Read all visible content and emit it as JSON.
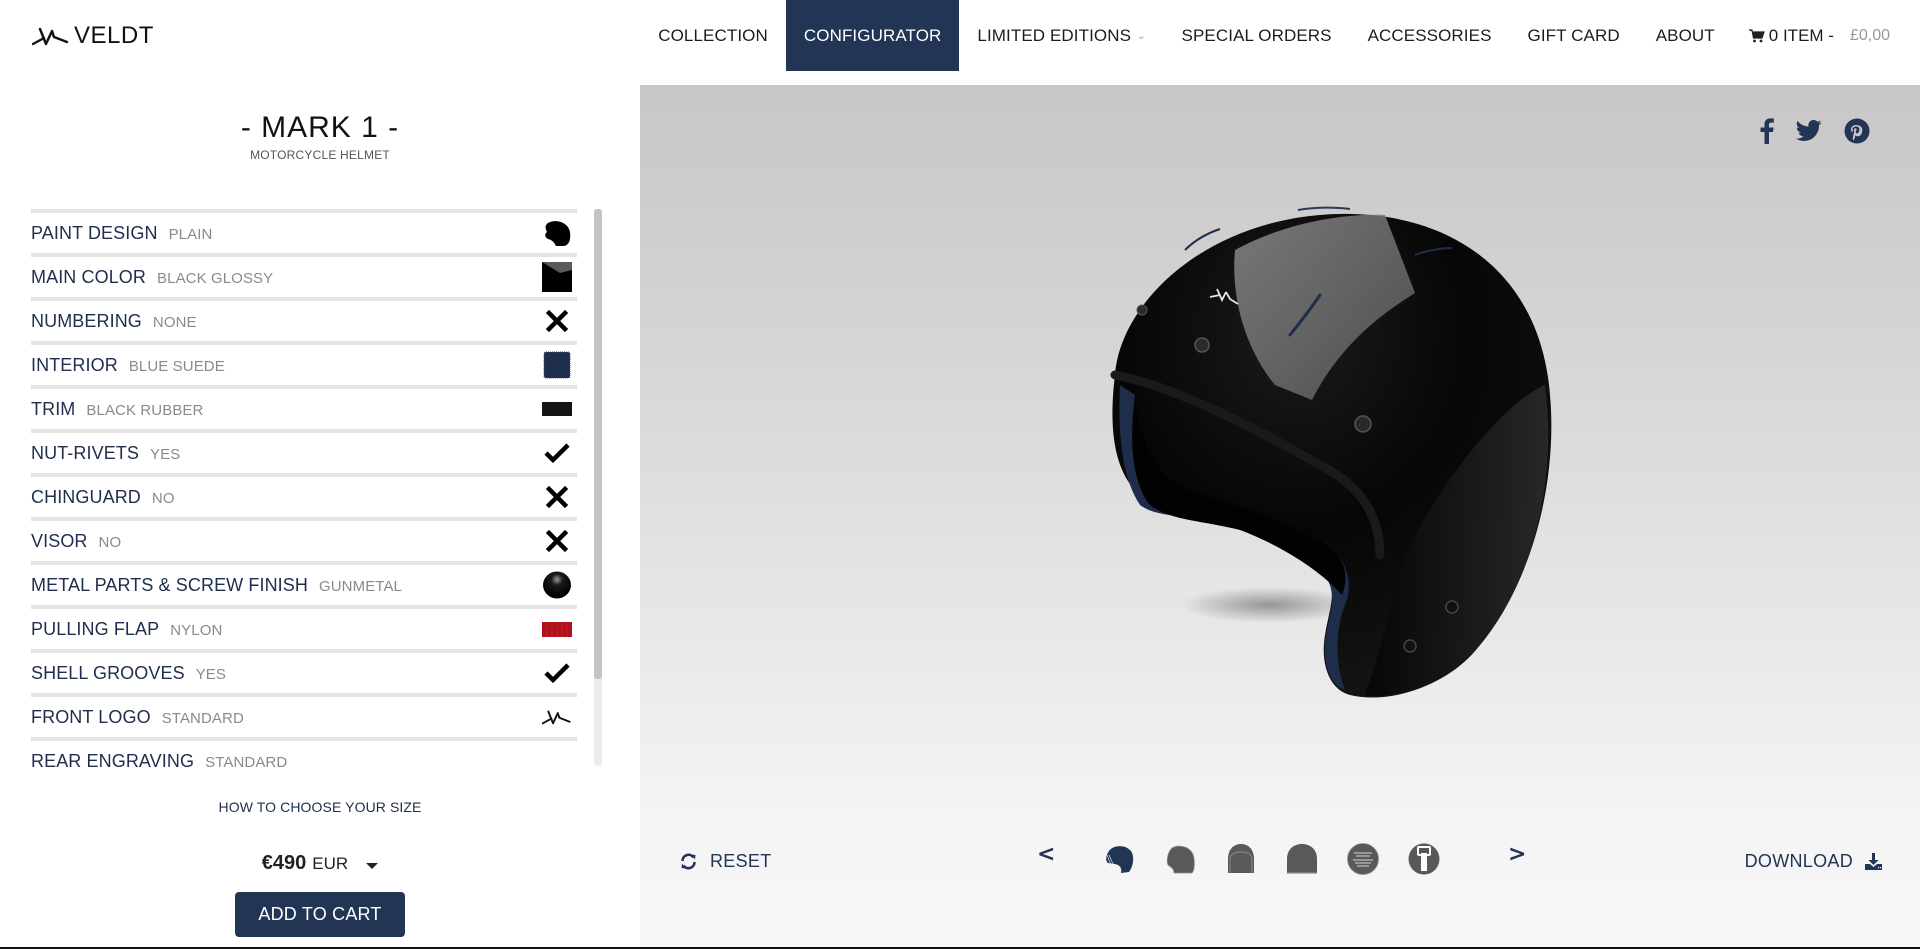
{
  "brand": {
    "name": "VELDT",
    "logo_icon": "veldt-mark-icon"
  },
  "nav": {
    "items": [
      {
        "label": "COLLECTION",
        "active": false,
        "has_dropdown": false
      },
      {
        "label": "CONFIGURATOR",
        "active": true,
        "has_dropdown": false
      },
      {
        "label": "LIMITED EDITIONS",
        "active": false,
        "has_dropdown": true
      },
      {
        "label": "SPECIAL ORDERS",
        "active": false,
        "has_dropdown": false
      },
      {
        "label": "ACCESSORIES",
        "active": false,
        "has_dropdown": false
      },
      {
        "label": "GIFT CARD",
        "active": false,
        "has_dropdown": false
      },
      {
        "label": "ABOUT",
        "active": false,
        "has_dropdown": false
      }
    ],
    "cart": {
      "icon": "cart-icon",
      "count_label": "0 ITEM -",
      "amount": "£0,00"
    }
  },
  "product": {
    "title": "- MARK 1 -",
    "subtitle": "MOTORCYCLE HELMET"
  },
  "options": [
    {
      "name": "PAINT DESIGN",
      "value": "PLAIN",
      "icon": "helmet-silhouette-icon"
    },
    {
      "name": "MAIN COLOR",
      "value": "BLACK GLOSSY",
      "icon": "black-glossy-swatch-icon"
    },
    {
      "name": "NUMBERING",
      "value": "NONE",
      "icon": "cross-icon"
    },
    {
      "name": "INTERIOR",
      "value": "BLUE SUEDE",
      "icon": "blue-suede-swatch-icon"
    },
    {
      "name": "TRIM",
      "value": "BLACK RUBBER",
      "icon": "black-rubber-swatch-icon"
    },
    {
      "name": "NUT-RIVETS",
      "value": "YES",
      "icon": "check-icon"
    },
    {
      "name": "CHINGUARD",
      "value": "NO",
      "icon": "cross-icon"
    },
    {
      "name": "VISOR",
      "value": "NO",
      "icon": "cross-icon"
    },
    {
      "name": "METAL PARTS & SCREW FINISH",
      "value": "GUNMETAL",
      "icon": "gunmetal-sphere-icon"
    },
    {
      "name": "PULLING FLAP",
      "value": "NYLON",
      "icon": "red-nylon-swatch-icon"
    },
    {
      "name": "SHELL GROOVES",
      "value": "YES",
      "icon": "check-icon"
    },
    {
      "name": "FRONT LOGO",
      "value": "STANDARD",
      "icon": "veldt-mark-icon"
    },
    {
      "name": "REAR ENGRAVING",
      "value": "STANDARD",
      "icon": ""
    }
  ],
  "sidebar_footer": {
    "size_link": "HOW TO CHOOSE YOUR SIZE",
    "price": "€490",
    "currency": "EUR",
    "add_to_cart": "ADD TO CART"
  },
  "viewer": {
    "social": [
      "facebook-icon",
      "twitter-icon",
      "pinterest-icon"
    ],
    "reset_label": "RESET",
    "prev_label": "<",
    "next_label": ">",
    "download_label": "DOWNLOAD",
    "views": [
      {
        "name": "three-quarter-view",
        "active": true
      },
      {
        "name": "side-view",
        "active": false
      },
      {
        "name": "front-view",
        "active": false
      },
      {
        "name": "back-view",
        "active": false
      },
      {
        "name": "engraving-view",
        "active": false
      },
      {
        "name": "flap-view",
        "active": false
      }
    ]
  },
  "colors": {
    "accent": "#223555",
    "option_name": "#1f2e4d",
    "option_value": "#8a8a8a",
    "divider": "#e4e4e4",
    "interior": "#1e2d4a",
    "pulling_flap": "#b0101a"
  }
}
